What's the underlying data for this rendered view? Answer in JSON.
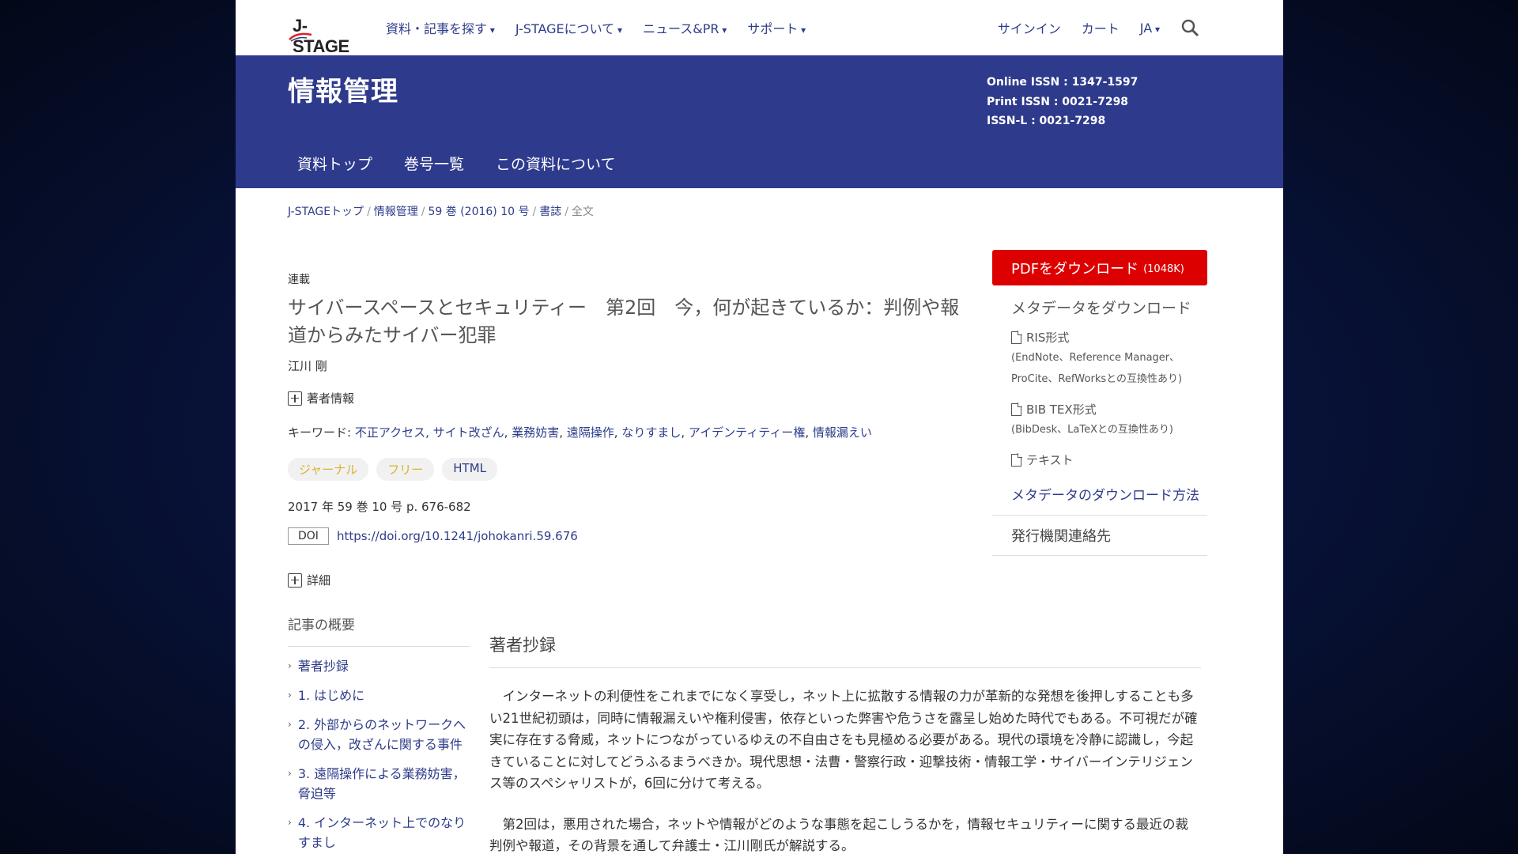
{
  "logo_text": "J-STAGE",
  "nav": {
    "items": [
      "資料・記事を探す",
      "J-STAGEについて",
      "ニュース&PR",
      "サポート"
    ],
    "signin": "サインイン",
    "cart": "カート",
    "lang": "JA"
  },
  "banner": {
    "title": "情報管理",
    "online_issn": "Online ISSN : 1347-1597",
    "print_issn": "Print ISSN : 0021-7298",
    "issn_l": "ISSN-L : 0021-7298",
    "tabs": [
      "資料トップ",
      "巻号一覧",
      "この資料について"
    ]
  },
  "breadcrumb": [
    "J-STAGEトップ",
    "情報管理",
    "59 巻 (2016) 10 号",
    "書誌",
    "全文"
  ],
  "article": {
    "category": "連載",
    "title": "サイバースペースとセキュリティー　第2回　今，何が起きているか：判例や報道からみたサイバー犯罪",
    "author": "江川 剛",
    "author_info": "著者情報",
    "keywords_label": "キーワード: ",
    "keywords": [
      "不正アクセス",
      "サイト改ざん",
      "業務妨害",
      "遠隔操作",
      "なりすまし",
      "アイデンティティー権",
      "情報漏えい"
    ],
    "badges": [
      "ジャーナル",
      "フリー",
      "HTML"
    ],
    "volume_info": "2017 年 59 巻 10 号 p. 676-682",
    "doi_label": "DOI",
    "doi": "https://doi.org/10.1241/johokanri.59.676",
    "detail": "詳細"
  },
  "sidebar": {
    "pdf_label": "PDFをダウンロード",
    "pdf_size": "(1048K)",
    "meta_head": "メタデータをダウンロード",
    "ris": "RIS形式",
    "ris_note1": "(EndNote、Reference Manager、",
    "ris_note2": "ProCite、RefWorksとの互換性あり)",
    "bib": "BIB TEX形式",
    "bib_note": "(BibDesk、LaTeXとの互換性あり)",
    "text": "テキスト",
    "meta_how": "メタデータのダウンロード方法",
    "publisher": "発行機関連絡先"
  },
  "toc": {
    "head": "記事の概要",
    "items": [
      "著者抄録",
      "1. はじめに",
      "2. 外部からのネットワークへの侵入，改ざんに関する事件",
      "3. 遠隔操作による業務妨害，脅迫等",
      "4. インターネット上でのなりすまし"
    ]
  },
  "abstract": {
    "head": "著者抄録",
    "p1": "インターネットの利便性をこれまでになく享受し，ネット上に拡散する情報の力が革新的な発想を後押しすることも多い21世紀初頭は，同時に情報漏えいや権利侵害，依存といった弊害や危うさを露呈し始めた時代でもある。不可視だが確実に存在する脅威，ネットにつながっているゆえの不自由さをも見極める必要がある。現代の環境を冷静に認識し，今起きていることに対してどうふるまうべきか。現代思想・法曹・警察行政・迎撃技術・情報工学・サイバーインテリジェンス等のスペシャリストが，6回に分けて考える。",
    "p2": "第2回は，悪用された場合，ネットや情報がどのような事態を起こしうるかを，情報セキュリティーに関する最近の裁判例や報道，その背景を通して弁護士・江川剛氏が解説する。"
  },
  "colors": {
    "banner": "#2e3a8c",
    "link": "#2e3c8a",
    "pdf_button": "#dd0000",
    "badge_yellow": "#d9b32a"
  }
}
